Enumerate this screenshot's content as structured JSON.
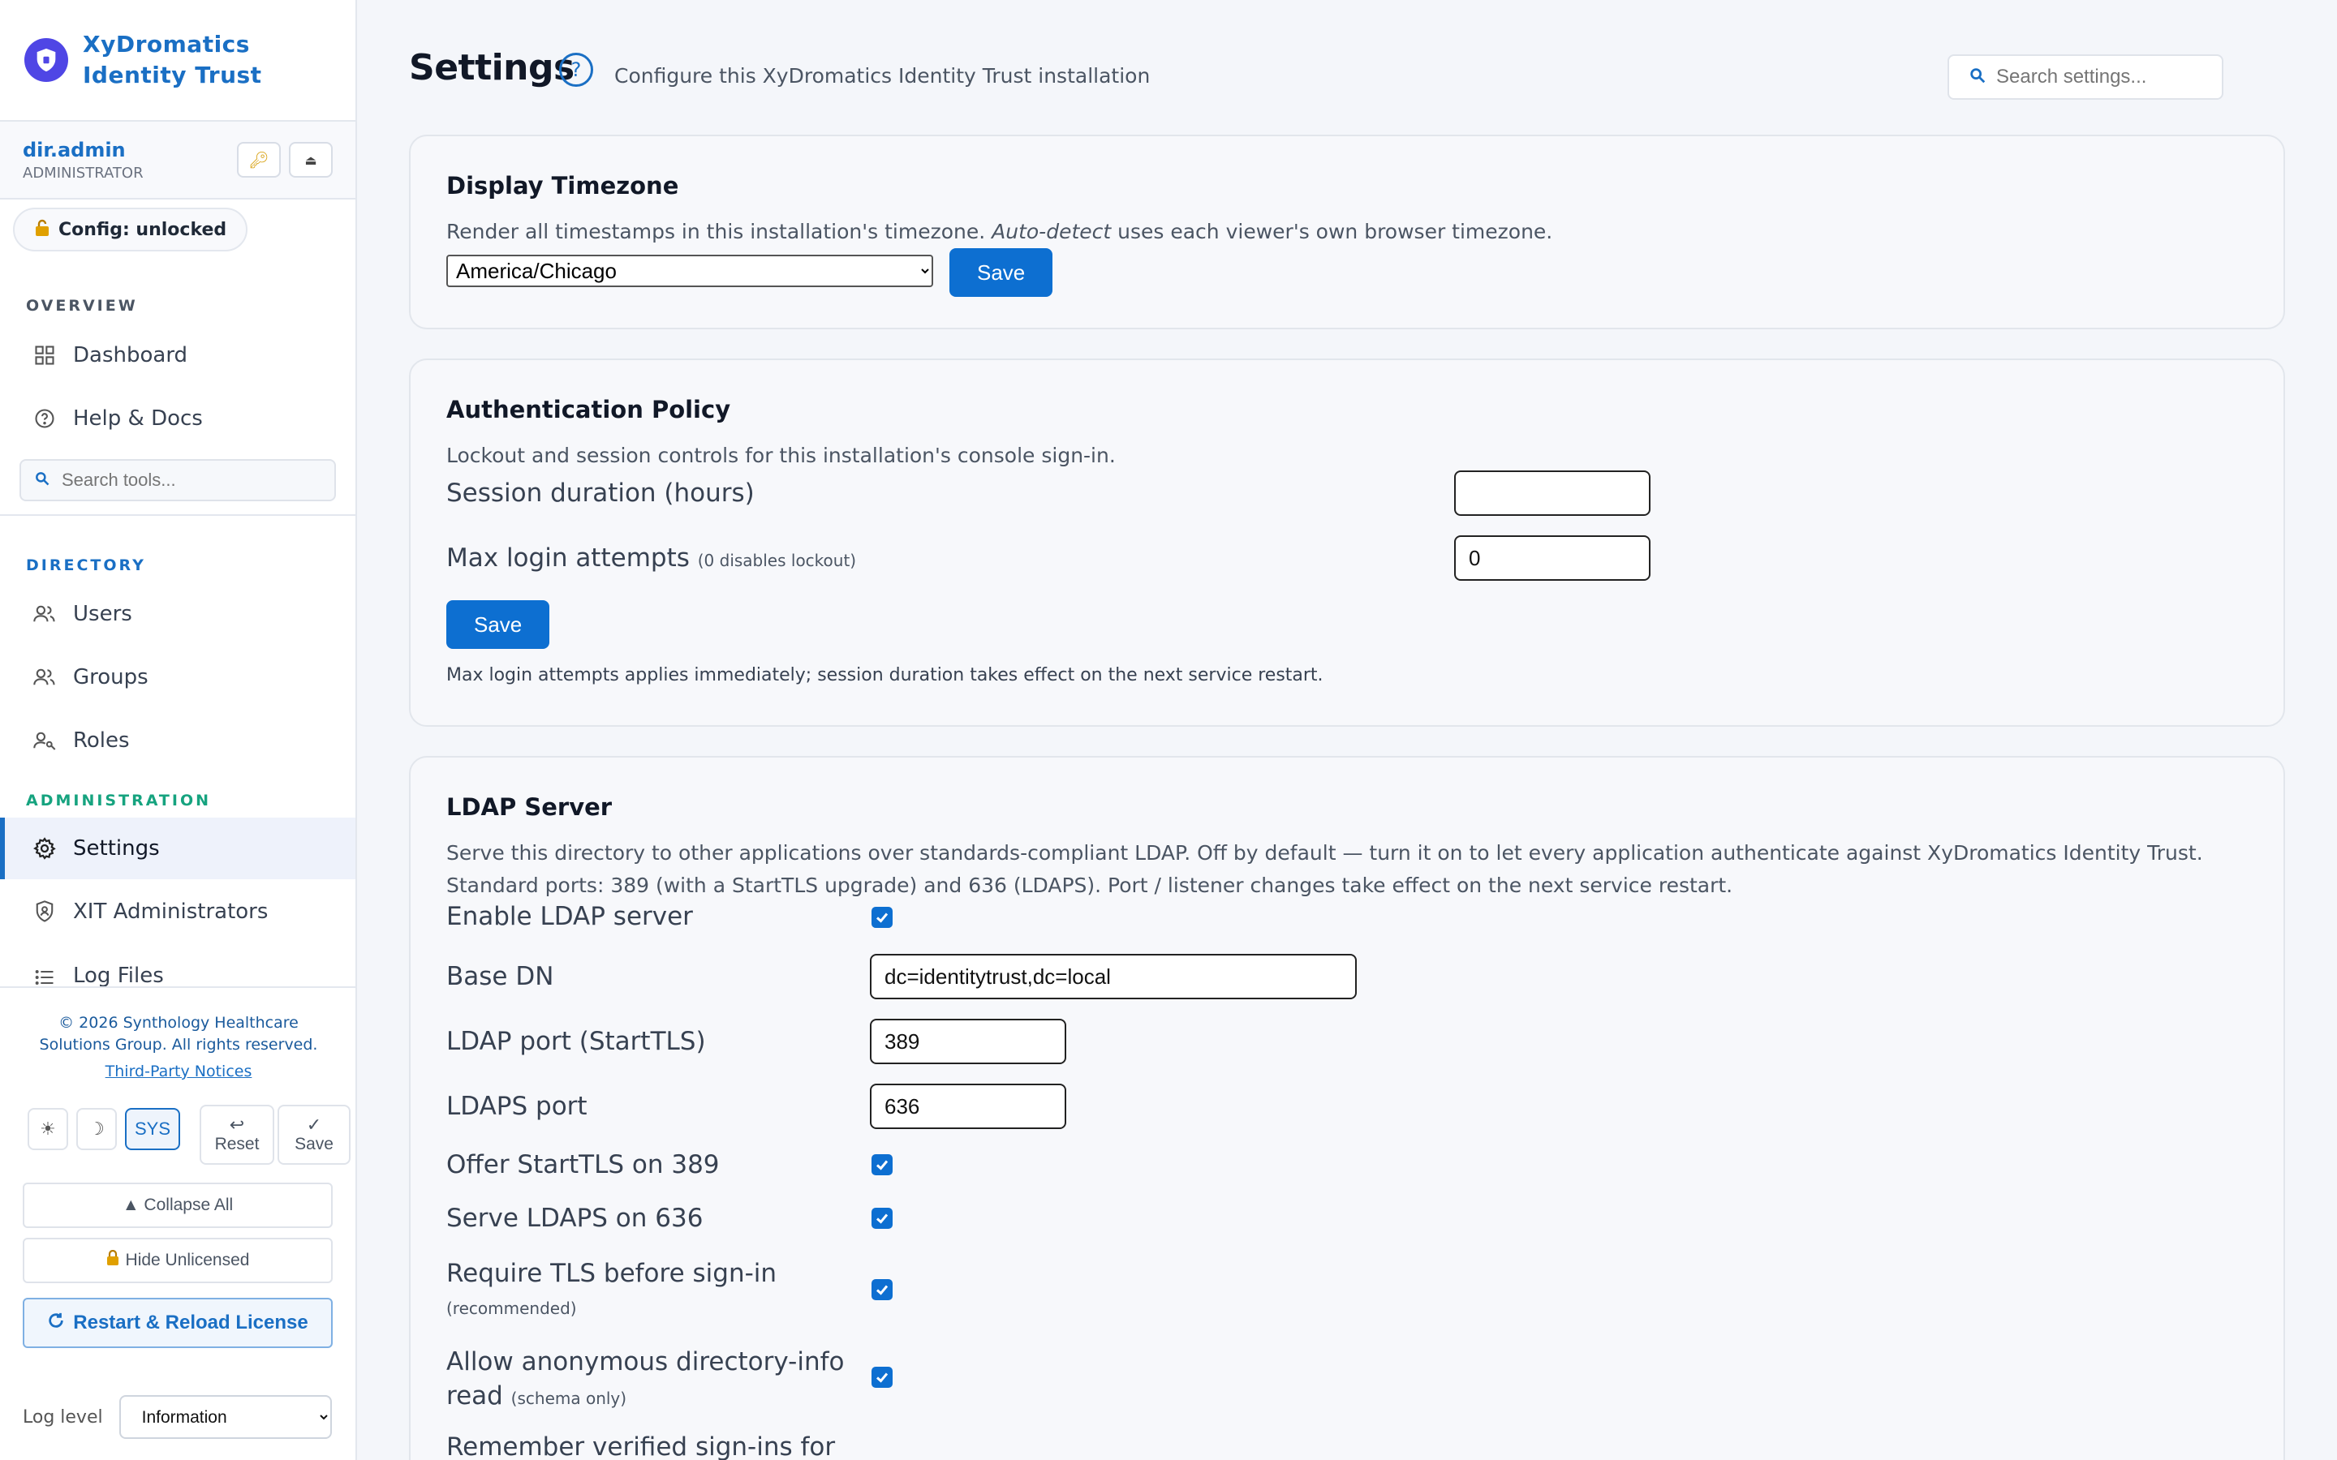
{
  "app": {
    "title": "XyDromatics Identity Trust"
  },
  "user": {
    "name": "dir.admin",
    "role": "ADMINISTRATOR"
  },
  "config_status": "Config: unlocked",
  "nav": {
    "overview_label": "OVERVIEW",
    "dashboard": "Dashboard",
    "help_docs": "Help & Docs",
    "tools_search_placeholder": "Search tools...",
    "directory_label": "DIRECTORY",
    "users": "Users",
    "groups": "Groups",
    "roles": "Roles",
    "administration_label": "ADMINISTRATION",
    "settings": "Settings",
    "xit_admins": "XIT Administrators",
    "log_files": "Log Files"
  },
  "footer": {
    "copyright": "© 2026 Synthology Healthcare Solutions Group. All rights reserved.",
    "third_party": "Third-Party Notices",
    "theme_sys": "SYS",
    "reset_label": "Reset",
    "save_label": "Save",
    "collapse_all": "▲ Collapse All",
    "hide_unlicensed": "Hide Unlicensed",
    "restart_reload": "Restart & Reload License",
    "log_level_label": "Log level",
    "log_level_value": "Information"
  },
  "page": {
    "title": "Settings",
    "subtitle": "Configure this XyDromatics Identity Trust installation",
    "search_placeholder": "Search settings..."
  },
  "timezone_card": {
    "title": "Display Timezone",
    "desc_before": "Render all timestamps in this installation's timezone. ",
    "desc_em": "Auto-detect",
    "desc_after": " uses each viewer's own browser timezone.",
    "selected": "America/Chicago",
    "save": "Save"
  },
  "auth_card": {
    "title": "Authentication Policy",
    "desc": "Lockout and session controls for this installation's console sign-in.",
    "session_label": "Session duration (hours)",
    "session_value": "",
    "max_label": "Max login attempts",
    "max_hint": "(0 disables lockout)",
    "max_value": "0",
    "save": "Save",
    "note": "Max login attempts applies immediately; session duration takes effect on the next service restart."
  },
  "ldap_card": {
    "title": "LDAP Server",
    "desc": "Serve this directory to other applications over standards-compliant LDAP. Off by default — turn it on to let every application authenticate against XyDromatics Identity Trust. Standard ports: 389 (with a StartTLS upgrade) and 636 (LDAPS). Port / listener changes take effect on the next service restart.",
    "enable_label": "Enable LDAP server",
    "base_dn_label": "Base DN",
    "base_dn_value": "dc=identitytrust,dc=local",
    "ldap_port_label": "LDAP port (StartTLS)",
    "ldap_port_value": "389",
    "ldaps_port_label": "LDAPS port",
    "ldaps_port_value": "636",
    "starttls_label": "Offer StartTLS on 389",
    "serve_ldaps_label": "Serve LDAPS on 636",
    "require_tls_label": "Require TLS before sign-in",
    "require_tls_hint": "(recommended)",
    "anon_label_1": "Allow anonymous directory-info",
    "anon_label_2": "read",
    "anon_hint": "(schema only)",
    "remember_label": "Remember verified sign-ins for"
  },
  "colors": {
    "accent": "#1a6fc4",
    "primary_button": "#0d6fd1",
    "brand_logo": "#4f46e5",
    "directory_section": "#1a6fc4",
    "administration_section": "#16a37f"
  }
}
